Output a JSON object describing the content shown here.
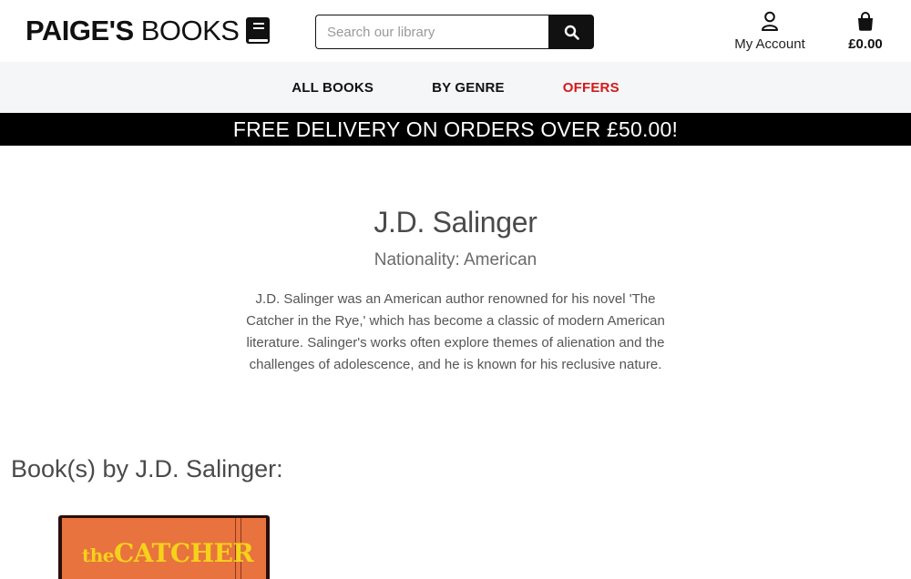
{
  "header": {
    "logo_bold": "PAIGE'S",
    "logo_light": "BOOKS",
    "search_placeholder": "Search our library",
    "account_label": "My Account",
    "bag_total": "£0.00"
  },
  "nav": {
    "items": [
      {
        "label": "ALL BOOKS"
      },
      {
        "label": "BY GENRE"
      },
      {
        "label": "OFFERS"
      }
    ]
  },
  "banner": {
    "text": "FREE DELIVERY ON ORDERS OVER £50.00!"
  },
  "author": {
    "name": "J.D. Salinger",
    "nationality": "Nationality: American",
    "bio": "J.D. Salinger was an American author renowned for his novel 'The Catcher in the Rye,' which has become a classic of modern American literature. Salinger's works often explore themes of alienation and the challenges of adolescence, and he is known for his reclusive nature."
  },
  "books": {
    "heading": "Book(s) by J.D. Salinger:",
    "items": [
      {
        "cover_word_1": "the",
        "cover_word_2": "CATCHER"
      }
    ]
  },
  "colors": {
    "offers": "#d11a1a",
    "banner_bg": "#000000",
    "nav_bg": "#f5f6f8",
    "cover_bg": "#e8733e",
    "cover_text": "#f5d21a"
  },
  "icons": {
    "logo": "book-icon",
    "search": "search-icon",
    "account": "user-icon",
    "bag": "shopping-bag-icon"
  }
}
